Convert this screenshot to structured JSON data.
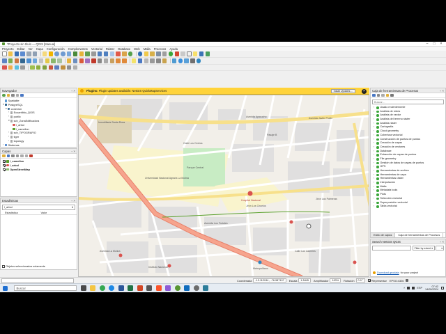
{
  "window": {
    "title": "*Proyecto sin título — QGIS [Manual]"
  },
  "menu": [
    "Proyecto",
    "Editar",
    "Ver",
    "Capa",
    "Configuración",
    "Complementos",
    "Vectorial",
    "Ráster",
    "Database",
    "Web",
    "Malla",
    "Procesos",
    "Ayuda"
  ],
  "colors": {
    "accent": "#ffd33a",
    "park": "#c8ecc4",
    "water": "#aad3df",
    "residential": "#e0dfdf",
    "major_road": "#f6a48d",
    "secondary_road": "#f7e08b",
    "campus": "#f9f4cd",
    "cemetery": "#ddd3b6"
  },
  "navigator": {
    "title": "Navegador",
    "items": [
      {
        "label": "Spatialite",
        "indent": 0,
        "icon": "feather-icon"
      },
      {
        "label": "PostgreSQL",
        "indent": 0,
        "icon": "elephant-icon"
      },
      {
        "label": "conexion",
        "indent": 1,
        "icon": "database-icon"
      },
      {
        "label": "Ecoanfibio_QGIS",
        "indent": 2,
        "icon": "schema-icon"
      },
      {
        "label": "public",
        "indent": 2,
        "icon": "schema-icon"
      },
      {
        "label": "sch_ZonaEdificadora",
        "indent": 2,
        "icon": "schema-icon"
      },
      {
        "label": "l_arbol",
        "indent": 3,
        "icon": "point-layer-icon"
      },
      {
        "label": "l_camellon",
        "indent": 3,
        "icon": "line-layer-icon"
      },
      {
        "label": "sch_TIPOGRAFIO",
        "indent": 2,
        "icon": "schema-icon"
      },
      {
        "label": "tiger",
        "indent": 2,
        "icon": "schema-icon"
      },
      {
        "label": "topology",
        "indent": 2,
        "icon": "schema-icon"
      },
      {
        "label": "Sistemas",
        "indent": 0,
        "icon": "folder-icon"
      }
    ]
  },
  "layers": {
    "title": "Capas",
    "items": [
      {
        "label": "l_camellon",
        "checked": true,
        "icon": "line-layer-icon"
      },
      {
        "label": "l_arbol",
        "checked": true,
        "icon": "point-layer-icon"
      },
      {
        "label": "OpenStreetMap",
        "checked": true,
        "icon": "tile-layer-icon"
      }
    ]
  },
  "statistics": {
    "title": "Estadísticas",
    "layer_value": "l_arbol",
    "col_stat": "Estadística",
    "col_value": "Valor"
  },
  "selected_objects_label": "Objetos seleccionados solamente",
  "notice": {
    "prefix": "Plugins:",
    "message": "Plugin updates available: NetGIS QuickMapServices",
    "button": "Install Updates…"
  },
  "processing": {
    "title": "Caja de herramientas de Procesos",
    "search_placeholder": "Buscar…",
    "items": [
      "Usado recientemente",
      "Análisis de redes",
      "Análisis de vector",
      "Análisis del terreno ráster",
      "Análisis ráster",
      "Cartografía",
      "Cloud geometry",
      "Cobertura vectorial",
      "Construcción de puntos de puntos",
      "Creación de capas",
      "Creación de vectores",
      "Database",
      "Extracción de capas de puntos",
      "File geometry",
      "Gestión de datos de capas de puntos",
      "GPS",
      "Herramientas de archivo",
      "Herramientas de capa",
      "Herramientas ráster",
      "Interpolación",
      "Malla",
      "Metadata tools",
      "Plots",
      "Selección vectorial",
      "Superposición vectorial",
      "Tabla vectorial"
    ]
  },
  "bottom_tabs": {
    "left": "Estilo de capas",
    "right": "Caja de herramientas de Procesos"
  },
  "plugin_search": {
    "title": "Search NetGIS QGIS",
    "field_value": "Filter by extent",
    "bottom_link": "Download geodata",
    "bottom_text": "for your project"
  },
  "map_labels": [
    "Inmobiliaria Santa Rosa",
    "Universidad Nacional Agraria La Molina",
    "Hospital Nacional",
    "Jirón Los Ciruelos",
    "Avenida Ayacucho",
    "Avenida Javier Prado",
    "Pasaje B",
    "Calle Los Cedros",
    "Avenida Los Frutales",
    "Calle Los Laureles",
    "Jirón Las Palmeras",
    "Avenida La Molina",
    "Parque Central",
    "Instituto Nacional",
    "Metropolitano"
  ],
  "status": {
    "coordinate_label": "Coordenada",
    "coordinate_value": "-13.112244 ; -76.987107",
    "scale_label": "Escala",
    "scale_value": "1:5445",
    "magnifier_label": "Amplificador",
    "magnifier_value": "100%",
    "rotation_label": "Rotación",
    "rotation_value": "0.0 °",
    "render_label": "Representar",
    "crs_value": "EPSG:4326"
  },
  "taskbar": {
    "search_placeholder": "Buscar",
    "time": "07:42",
    "date": "14/05/2024",
    "lang": "ESP"
  }
}
